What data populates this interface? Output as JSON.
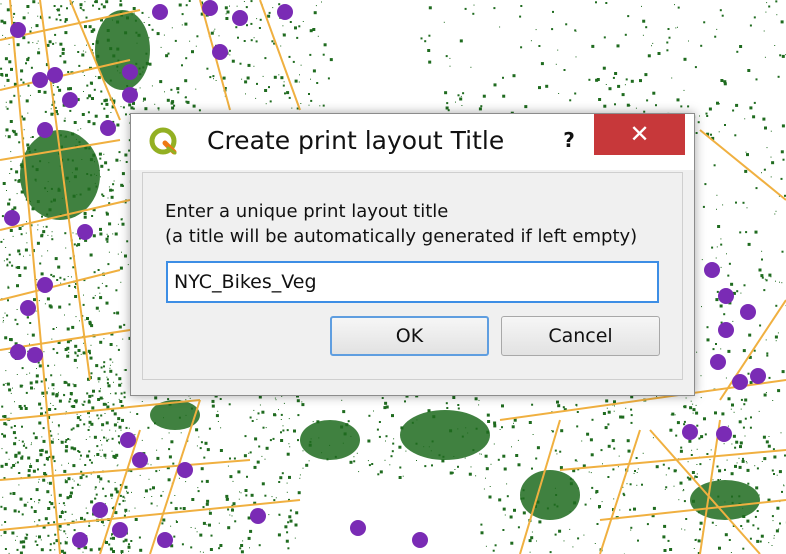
{
  "dialog": {
    "title": "Create print layout Title",
    "help_label": "?",
    "close_label": "✕",
    "prompt_line1": "Enter a unique print layout title",
    "prompt_line2": "(a title will be automatically generated if left empty)",
    "input_value": "NYC_Bikes_Veg",
    "ok_label": "OK",
    "cancel_label": "Cancel"
  },
  "map": {
    "colors": {
      "vegetation": "#1f6b1f",
      "roads": "#f0b040",
      "stations": "#7a2bb5",
      "background": "#ffffff"
    }
  },
  "icons": {
    "app": "qgis-logo-icon",
    "help": "help-icon",
    "close": "close-icon"
  }
}
